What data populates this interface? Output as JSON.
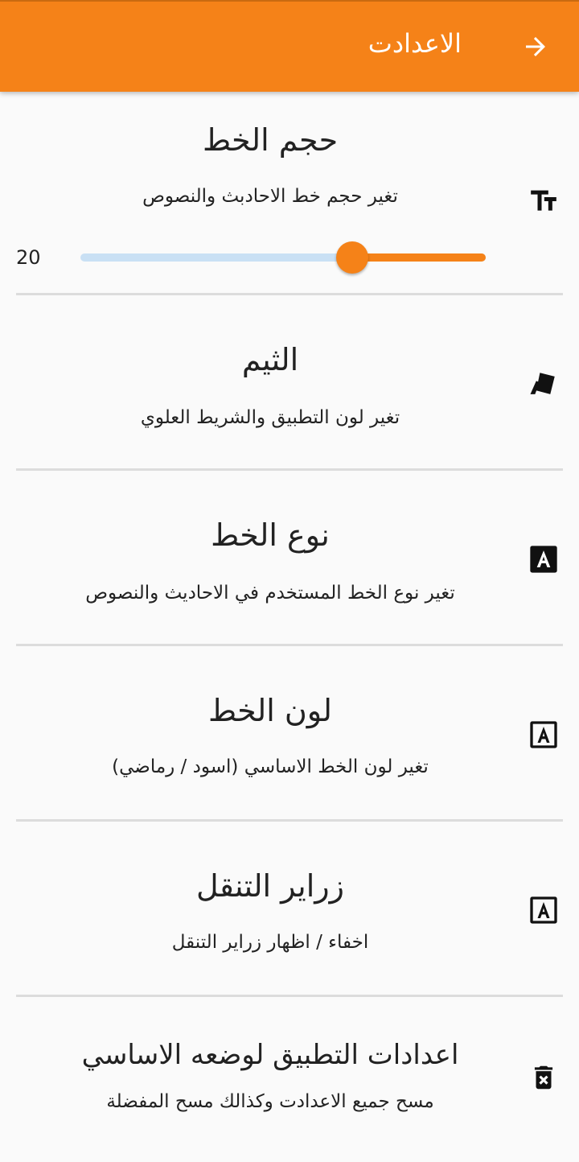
{
  "app_bar": {
    "title": "الاعدادت",
    "back_icon": "arrow-forward-icon",
    "background": "#f58218"
  },
  "font_size": {
    "title": "حجم الخط",
    "subtitle": "تغير حجم خط الاحادبث والنصوص",
    "icon": "text-size-icon",
    "slider": {
      "value": "20",
      "level_fraction": 0.67
    }
  },
  "theme": {
    "title": "الثيم",
    "subtitle": "تغير لون التطبيق والشريط العلوي",
    "icon": "palette-cards-icon"
  },
  "font_type": {
    "title": "نوع الخط",
    "subtitle": "تغير نوع الخط المستخدم في الاحاديث والنصوص",
    "icon": "font-type-icon"
  },
  "font_color": {
    "title": "لون الخط",
    "subtitle": "تغير لون الخط الاساسي (اسود / رماضي)",
    "icon": "font-color-icon"
  },
  "nav_buttons": {
    "title": "زراير التنقل",
    "subtitle": "اخفاء / اظهار زراير التنقل",
    "icon": "nav-buttons-icon"
  },
  "reset": {
    "title": "اعدادات التطبيق لوضعه الاساسي",
    "subtitle": "مسح جميع الاعدادت وكذالك مسح المفضلة",
    "icon": "delete-forever-icon"
  },
  "colors": {
    "accent": "#f58218",
    "slider_inactive": "#c9e0f4",
    "divider": "#dcdcdc"
  }
}
